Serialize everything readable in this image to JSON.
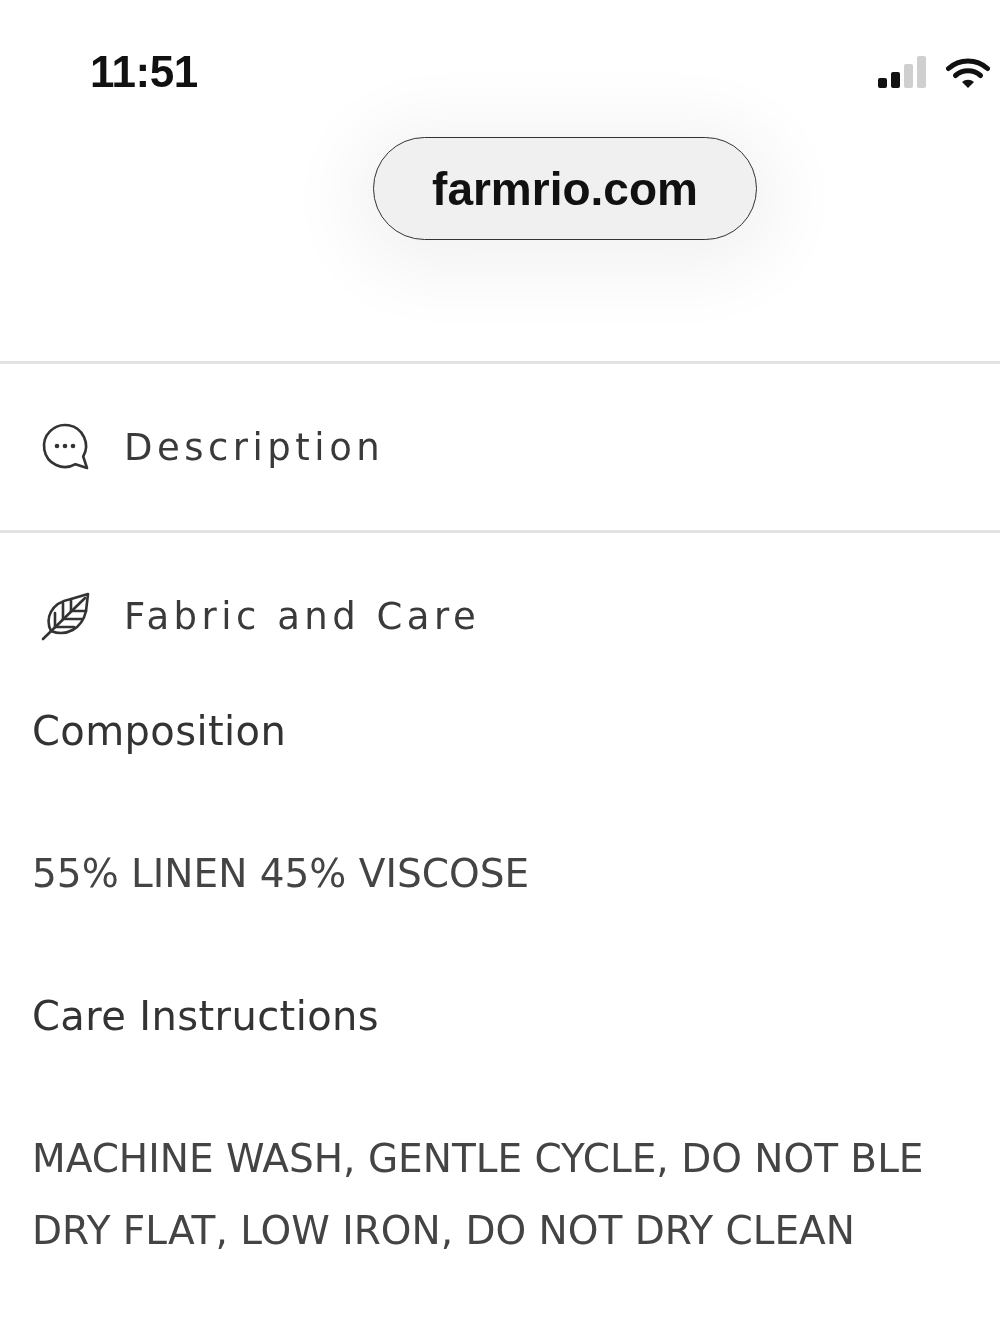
{
  "status_bar": {
    "time": "11:51"
  },
  "address_bar": {
    "url": "farmrio.com"
  },
  "sections": [
    {
      "kind": "description",
      "title": "Description"
    },
    {
      "kind": "fabric",
      "title": "Fabric and Care",
      "details": [
        {
          "heading": "Composition",
          "lines": [
            "55% LINEN 45% VISCOSE"
          ]
        },
        {
          "heading": "Care Instructions",
          "lines": [
            "MACHINE WASH, GENTLE CYCLE, DO NOT BLE",
            "DRY FLAT, LOW IRON, DO NOT DRY CLEAN"
          ]
        }
      ]
    }
  ]
}
